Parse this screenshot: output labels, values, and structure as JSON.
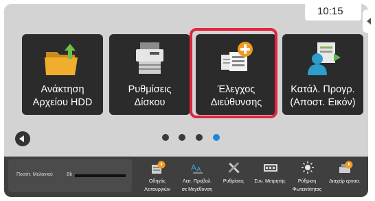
{
  "status": {
    "time": "10:15"
  },
  "tiles": [
    {
      "line1": "Ανάκτηση",
      "line2": "Αρχείου HDD",
      "icon": "folder-upload-icon"
    },
    {
      "line1": "Ρυθμίσεις",
      "line2": "Δίσκου",
      "icon": "printer-icon"
    },
    {
      "line1": "Έλεγχος",
      "line2": "Διεύθυνσης",
      "icon": "address-book-add-icon"
    },
    {
      "line1": "Κατάλ. Προγρ.",
      "line2": "(Αποστ. Εικόν)",
      "icon": "user-document-send-icon"
    }
  ],
  "pagination": {
    "count": 4,
    "active_index": 3
  },
  "toner": {
    "label": "Ποσότ. Μελανιού",
    "color_label": "Bk"
  },
  "quick_actions": [
    {
      "line1": "Οδηγός",
      "line2": "Λειτουργιών",
      "icon": "help-guide-icon"
    },
    {
      "line1": "Λειτ. Προβολ.",
      "line2": "σε Μεγέθυνση",
      "icon": "zoom-text-icon"
    },
    {
      "line1": "Ρυθμίσεις",
      "line2": "",
      "icon": "tools-icon"
    },
    {
      "line1": "Συν. Μετρητής",
      "line2": "",
      "icon": "counter-icon"
    },
    {
      "line1": "Ρύθμιση",
      "line2": "Φωτεινότητας",
      "icon": "brightness-icon"
    },
    {
      "line1": "Διαχείρ εργασ.",
      "line2": "",
      "icon": "job-status-icon"
    }
  ],
  "colors": {
    "accent": "#1e86d8",
    "highlight": "#e0263f",
    "tile_bg": "#2b2b2b"
  }
}
